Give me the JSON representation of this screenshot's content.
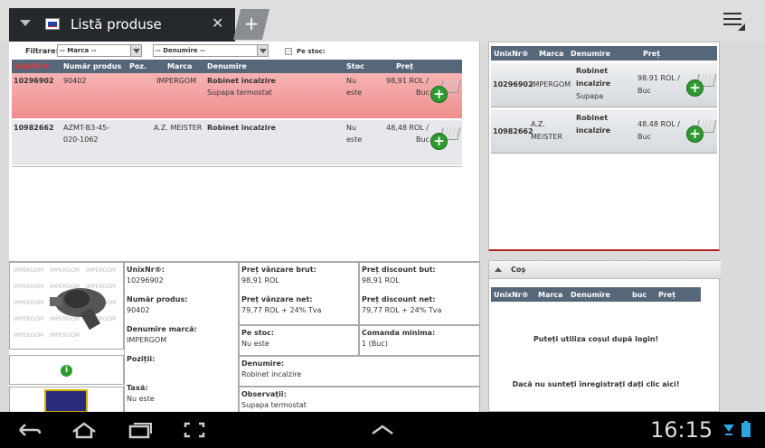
{
  "tab": {
    "title": "Listă produse",
    "close": "✕",
    "new": "+"
  },
  "filters": {
    "label": "Filtrare:",
    "marca": "-- Marca --",
    "denumire": "-- Denumire --",
    "stoc_label": "Pe stoc:"
  },
  "table": {
    "headers": [
      "UnixNr®",
      "Număr produs",
      "Poz.",
      "Marca",
      "Denumire",
      "Stoc",
      "Preț"
    ],
    "rows": [
      {
        "unix": "10296902",
        "numar": "90402",
        "poz": "",
        "marca": "IMPERGOM",
        "den1": "Robinet incalzire",
        "den2": "Supapa termostat",
        "stoc1": "Nu",
        "stoc2": "este",
        "pret1": "98,91 ROL /",
        "pret2": "Buc"
      },
      {
        "unix": "10982662",
        "numar": "AZMT-B3-45-",
        "numar2": "020-1062",
        "poz": "",
        "marca": "A.Z. MEISTER",
        "den1": "Robinet incalzire",
        "den2": "",
        "stoc1": "Nu",
        "stoc2": "este",
        "pret1": "48,48 ROL /",
        "pret2": "Buc"
      }
    ]
  },
  "detail": {
    "unix_k": "UnixNr®:",
    "unix_v": "10296902",
    "numar_k": "Număr produs:",
    "numar_v": "90402",
    "marca_k": "Denumire marcă:",
    "marca_v": "IMPERGOM",
    "pozitii_k": "Poziții:",
    "taxa_k": "Taxă:",
    "taxa_v": "Nu este",
    "pvb_k": "Preț vânzare brut:",
    "pvb_v": "98,91 ROL",
    "pvn_k": "Preț vânzare net:",
    "pvn_v": "79,77 ROL + 24% Tva",
    "stoc_k": "Pe stoc:",
    "stoc_v": "Nu este",
    "den_k": "Denumire:",
    "den_v": "Robinet incalzire",
    "obs_k": "Observații:",
    "obs_v": "Supapa termostat",
    "pdb_k": "Preț discount but:",
    "pdb_v": "98,91 ROL",
    "pdn_k": "Preț discount net:",
    "pdn_v": "79,77 ROL + 24% Tva",
    "cmd_k": "Comanda minima:",
    "cmd_v": "1 (Buc)",
    "brand_watermark": "IMPERGOM"
  },
  "compare": {
    "headers": [
      "UnixNr®",
      "Marca",
      "Denumire",
      "Preț"
    ],
    "rows": [
      {
        "unix": "10296902",
        "marca": "IMPERGOM",
        "den1": "Robinet",
        "den2": "incalzire",
        "den3": "Supapa",
        "pret1": "98.91 ROL /",
        "pret2": "Buc"
      },
      {
        "unix": "10982662",
        "marca1": "A.Z.",
        "marca2": "MEISTER",
        "den1": "Robinet",
        "den2": "incalzire",
        "pret1": "48.48 ROL /",
        "pret2": "Buc"
      }
    ]
  },
  "cos": {
    "title": "Coș",
    "headers": [
      "UnixNr®",
      "Marca",
      "Denumire",
      "buc",
      "Preț"
    ],
    "msg1": "Puteți utiliza coșul după login!",
    "msg2": "Dacă nu sunteți înregistrați dați clic aici!"
  },
  "statusbar": {
    "time": "16:15"
  },
  "colors": {
    "header_bg": "#57677a",
    "row_highlight": "#f4a6a6",
    "accent_red": "#b42020",
    "cart_green": "#2f9a31"
  }
}
